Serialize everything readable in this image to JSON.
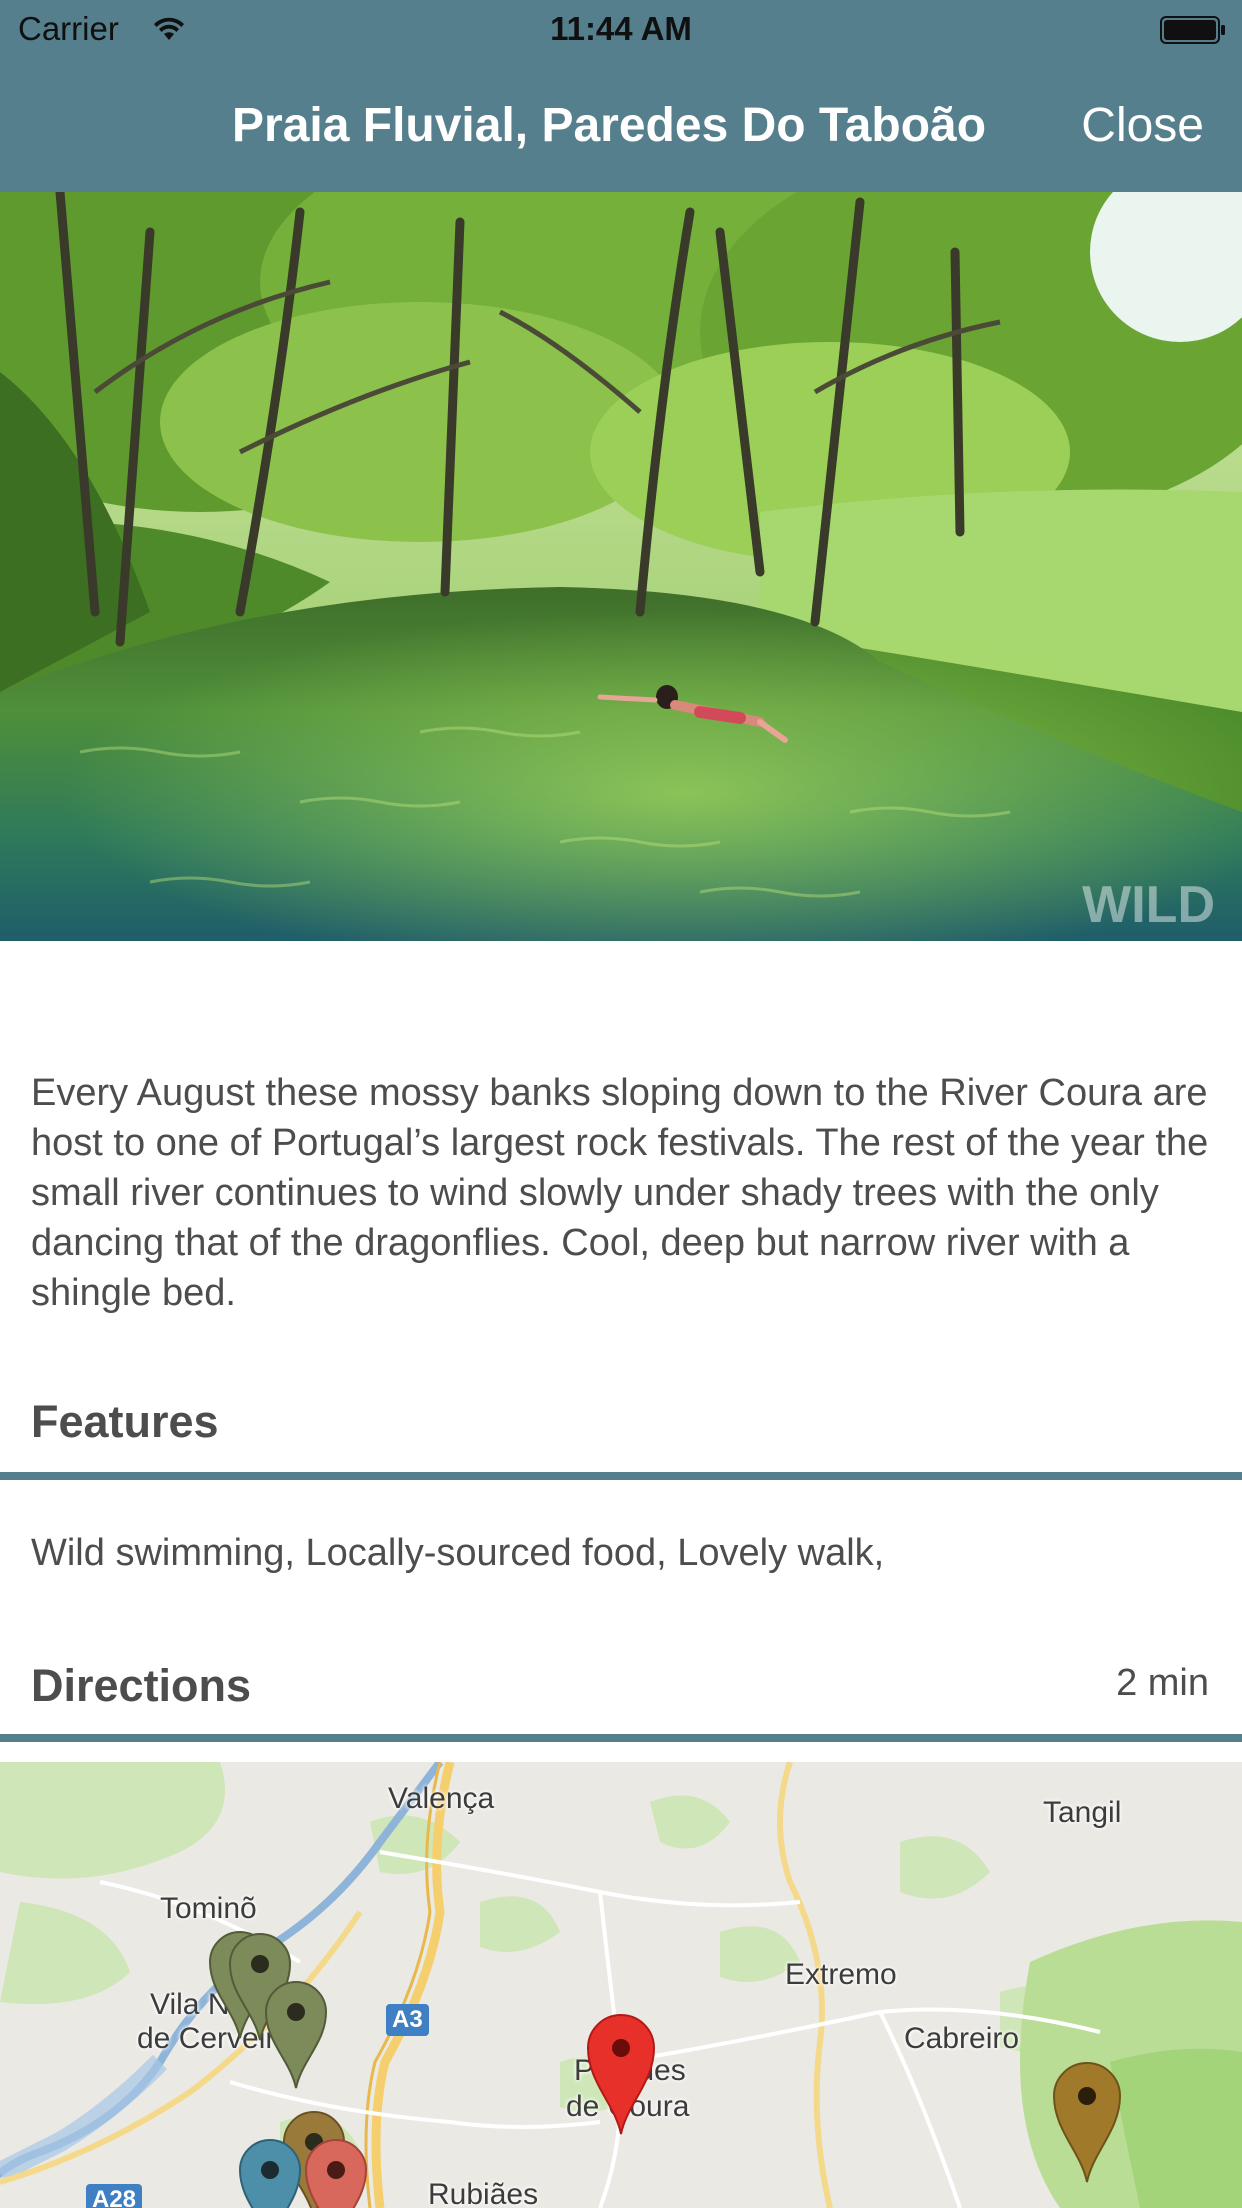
{
  "status_bar": {
    "carrier": "Carrier",
    "time": "11:44 AM"
  },
  "nav": {
    "title": "Praia Fluvial, Paredes Do Taboão",
    "close_label": "Close"
  },
  "hero": {
    "watermark": "WILD"
  },
  "description": "Every August these mossy banks sloping down to the River Coura are host to one of Portugal’s largest rock festivals. The rest of the year the small river continues to wind slowly under shady trees with the only dancing that of the dragonflies. Cool, deep but narrow river with a shingle bed.",
  "features": {
    "title": "Features",
    "text": "Wild swimming, Locally-sourced food, Lovely walk,"
  },
  "directions": {
    "title": "Directions",
    "time": "2 min"
  },
  "map": {
    "labels": {
      "valenca": "Valença",
      "tangil": "Tangil",
      "tomino": "Tominõ",
      "extremo": "Extremo",
      "vila_nova": "Vila Nova",
      "de_cerveira": "de Cerveira",
      "cabreiro": "Cabreiro",
      "paredes": "Paredes",
      "de_coura": "de Coura",
      "rubiaes": "Rubiães"
    },
    "roads": {
      "a3": "A3",
      "a28": "A28"
    }
  },
  "colors": {
    "nav_background": "#567f8d",
    "accent_rule": "#567f8d",
    "selected_pin": "#e8302b"
  }
}
